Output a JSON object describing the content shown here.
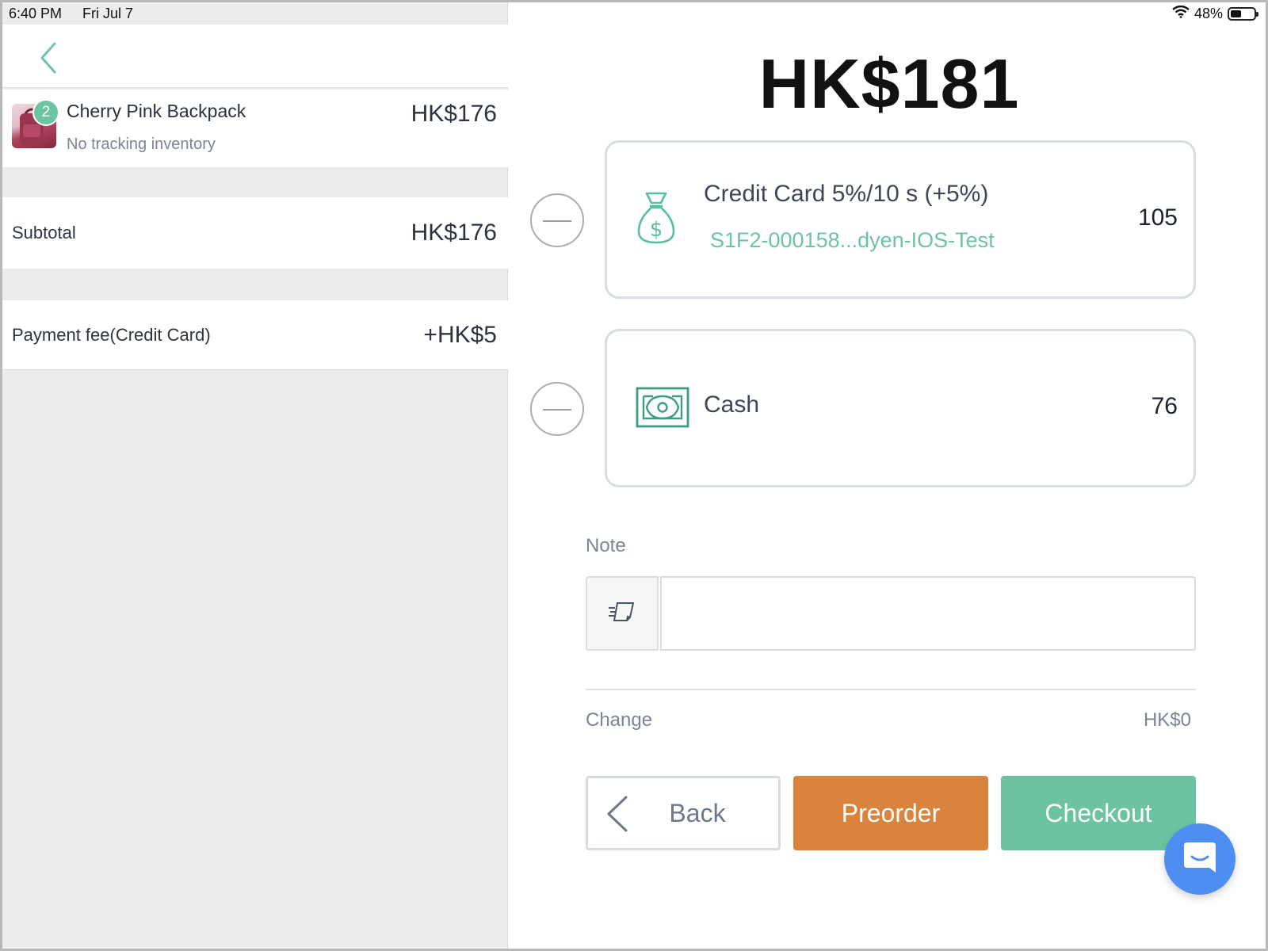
{
  "status_bar": {
    "time": "6:40 PM",
    "date": "Fri Jul 7",
    "battery_text": "48%",
    "battery_level": 0.48
  },
  "cart": {
    "item": {
      "name": "Cherry Pink Backpack",
      "subtitle": "No tracking inventory",
      "price": "HK$176",
      "quantity": "2"
    },
    "subtotal_label": "Subtotal",
    "subtotal_value": "HK$176",
    "fee_label": "Payment fee(Credit Card)",
    "fee_value": "+HK$5"
  },
  "payment": {
    "total": "HK$181",
    "methods": [
      {
        "title": "Credit Card 5%/10   s (+5%)",
        "subtitle": "S1F2-000158...dyen-IOS-Test",
        "amount": "105",
        "icon": "money-bag-icon"
      },
      {
        "title": "Cash",
        "amount": "76",
        "icon": "cash-bill-icon"
      }
    ],
    "note_label": "Note",
    "note_value": "",
    "change_label": "Change",
    "change_value": "HK$0"
  },
  "actions": {
    "back_label": "Back",
    "preorder_label": "Preorder",
    "checkout_label": "Checkout"
  },
  "colors": {
    "accent_green": "#6cc5a2",
    "preorder_orange": "#d9833c",
    "checkout_green": "#6cc3a1",
    "chat_blue": "#4d8ef0"
  }
}
